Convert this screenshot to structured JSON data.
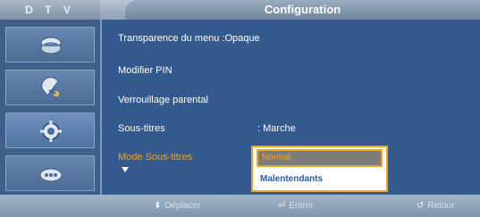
{
  "header": {
    "tv_label": "D T V",
    "title": "Configuration"
  },
  "menu": {
    "items": [
      {
        "label": "Transparence du menu",
        "value": ":Opaque"
      },
      {
        "label": "Modifier PIN",
        "value": ""
      },
      {
        "label": "Verrouillage parental",
        "value": ""
      },
      {
        "label": "Sous-titres",
        "value": ": Marche"
      },
      {
        "label": "Mode Sous-titres",
        "value": ""
      }
    ]
  },
  "dropdown": {
    "selected": "Normal",
    "options": [
      "Normal",
      "Malentendants"
    ]
  },
  "footer": {
    "move": "Déplacer",
    "enter": "Entrer",
    "back": "Retour"
  },
  "icons": [
    "channel-icon",
    "satellite-dish-icon",
    "setup-gear-icon",
    "input-plug-icon"
  ],
  "colors": {
    "accent": "#f3a51e",
    "panel": "#34598c",
    "titlebar": "#8fa1b4",
    "highlight_text": "#2d5a9a"
  }
}
